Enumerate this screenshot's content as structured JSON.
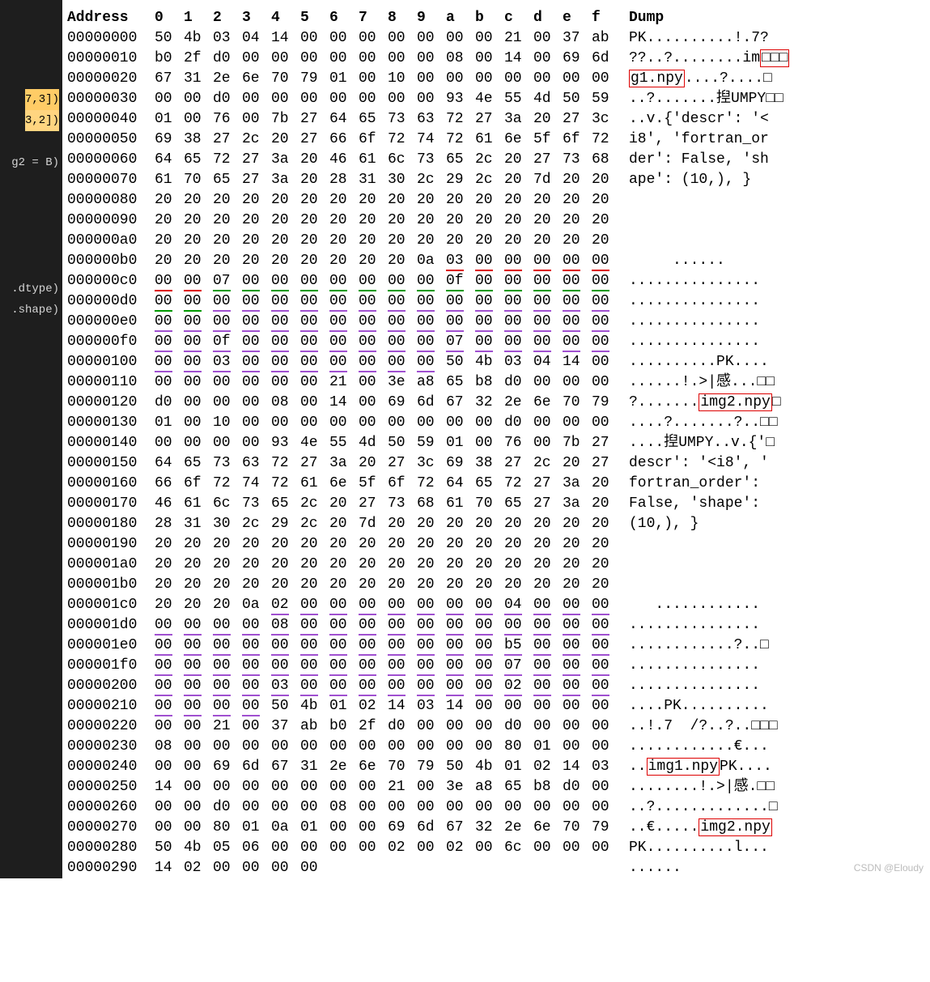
{
  "watermark": "CSDN @Eloudy",
  "left_panel": {
    "l1": "7,3])",
    "l2": "3,2])",
    "l3": "g2 = B)",
    "l4": ".dtype)",
    "l5": ".shape)"
  },
  "headers": [
    "Address",
    "0",
    "1",
    "2",
    "3",
    "4",
    "5",
    "6",
    "7",
    "8",
    "9",
    "a",
    "b",
    "c",
    "d",
    "e",
    "f",
    "Dump"
  ],
  "rows": [
    {
      "a": "00000000",
      "h": [
        "50",
        "4b",
        "03",
        "04",
        "14",
        "00",
        "00",
        "00",
        "00",
        "00",
        "00",
        "00",
        "21",
        "00",
        "37",
        "ab"
      ],
      "d": "PK..........!.7?",
      "u": []
    },
    {
      "a": "00000010",
      "h": [
        "b0",
        "2f",
        "d0",
        "00",
        "00",
        "00",
        "00",
        "00",
        "00",
        "00",
        "08",
        "00",
        "14",
        "00",
        "69",
        "6d"
      ],
      "d": "??..?........im□□□",
      "u": [],
      "dumpBox": [
        15,
        20
      ]
    },
    {
      "a": "00000020",
      "h": [
        "67",
        "31",
        "2e",
        "6e",
        "70",
        "79",
        "01",
        "00",
        "10",
        "00",
        "00",
        "00",
        "00",
        "00",
        "00",
        "00"
      ],
      "d": "g1.npy....?....□",
      "u": [],
      "dumpBox": [
        0,
        6
      ]
    },
    {
      "a": "00000030",
      "h": [
        "00",
        "00",
        "d0",
        "00",
        "00",
        "00",
        "00",
        "00",
        "00",
        "00",
        "93",
        "4e",
        "55",
        "4d",
        "50",
        "59"
      ],
      "d": "..?.......揑UMPY□□",
      "u": []
    },
    {
      "a": "00000040",
      "h": [
        "01",
        "00",
        "76",
        "00",
        "7b",
        "27",
        "64",
        "65",
        "73",
        "63",
        "72",
        "27",
        "3a",
        "20",
        "27",
        "3c"
      ],
      "d": "..v.{'descr': '<",
      "u": []
    },
    {
      "a": "00000050",
      "h": [
        "69",
        "38",
        "27",
        "2c",
        "20",
        "27",
        "66",
        "6f",
        "72",
        "74",
        "72",
        "61",
        "6e",
        "5f",
        "6f",
        "72"
      ],
      "d": "i8', 'fortran_or",
      "u": []
    },
    {
      "a": "00000060",
      "h": [
        "64",
        "65",
        "72",
        "27",
        "3a",
        "20",
        "46",
        "61",
        "6c",
        "73",
        "65",
        "2c",
        "20",
        "27",
        "73",
        "68"
      ],
      "d": "der': False, 'sh",
      "u": []
    },
    {
      "a": "00000070",
      "h": [
        "61",
        "70",
        "65",
        "27",
        "3a",
        "20",
        "28",
        "31",
        "30",
        "2c",
        "29",
        "2c",
        "20",
        "7d",
        "20",
        "20"
      ],
      "d": "ape': (10,), }  ",
      "u": []
    },
    {
      "a": "00000080",
      "h": [
        "20",
        "20",
        "20",
        "20",
        "20",
        "20",
        "20",
        "20",
        "20",
        "20",
        "20",
        "20",
        "20",
        "20",
        "20",
        "20"
      ],
      "d": "",
      "u": []
    },
    {
      "a": "00000090",
      "h": [
        "20",
        "20",
        "20",
        "20",
        "20",
        "20",
        "20",
        "20",
        "20",
        "20",
        "20",
        "20",
        "20",
        "20",
        "20",
        "20"
      ],
      "d": "",
      "u": []
    },
    {
      "a": "000000a0",
      "h": [
        "20",
        "20",
        "20",
        "20",
        "20",
        "20",
        "20",
        "20",
        "20",
        "20",
        "20",
        "20",
        "20",
        "20",
        "20",
        "20"
      ],
      "d": "",
      "u": []
    },
    {
      "a": "000000b0",
      "h": [
        "20",
        "20",
        "20",
        "20",
        "20",
        "20",
        "20",
        "20",
        "20",
        "0a",
        "03",
        "00",
        "00",
        "00",
        "00",
        "00"
      ],
      "d": "     ......",
      "u": [
        [
          "red",
          10,
          15
        ]
      ]
    },
    {
      "a": "000000c0",
      "h": [
        "00",
        "00",
        "07",
        "00",
        "00",
        "00",
        "00",
        "00",
        "00",
        "00",
        "0f",
        "00",
        "00",
        "00",
        "00",
        "00"
      ],
      "d": "...............",
      "u": [
        [
          "red",
          0,
          1
        ],
        [
          "grn",
          2,
          9
        ],
        [
          "grn",
          10,
          15
        ]
      ]
    },
    {
      "a": "000000d0",
      "h": [
        "00",
        "00",
        "00",
        "00",
        "00",
        "00",
        "00",
        "00",
        "00",
        "00",
        "00",
        "00",
        "00",
        "00",
        "00",
        "00"
      ],
      "d": "...............",
      "u": [
        [
          "grn",
          0,
          1
        ],
        [
          "pur",
          2,
          9
        ],
        [
          "pur",
          10,
          15
        ]
      ]
    },
    {
      "a": "000000e0",
      "h": [
        "00",
        "00",
        "00",
        "00",
        "00",
        "00",
        "00",
        "00",
        "00",
        "00",
        "00",
        "00",
        "00",
        "00",
        "00",
        "00"
      ],
      "d": "...............",
      "u": [
        [
          "pur",
          0,
          1
        ],
        [
          "pur",
          2,
          9
        ],
        [
          "pur",
          10,
          15
        ]
      ]
    },
    {
      "a": "000000f0",
      "h": [
        "00",
        "00",
        "0f",
        "00",
        "00",
        "00",
        "00",
        "00",
        "00",
        "00",
        "07",
        "00",
        "00",
        "00",
        "00",
        "00"
      ],
      "d": "...............",
      "u": [
        [
          "pur",
          0,
          1
        ],
        [
          "pur",
          2,
          9
        ],
        [
          "pur",
          10,
          15
        ]
      ]
    },
    {
      "a": "00000100",
      "h": [
        "00",
        "00",
        "03",
        "00",
        "00",
        "00",
        "00",
        "00",
        "00",
        "00",
        "50",
        "4b",
        "03",
        "04",
        "14",
        "00"
      ],
      "d": "..........PK....",
      "u": [
        [
          "pur",
          0,
          1
        ],
        [
          "pur",
          2,
          9
        ]
      ]
    },
    {
      "a": "00000110",
      "h": [
        "00",
        "00",
        "00",
        "00",
        "00",
        "00",
        "21",
        "00",
        "3e",
        "a8",
        "65",
        "b8",
        "d0",
        "00",
        "00",
        "00"
      ],
      "d": "......!.>|感...□□",
      "u": []
    },
    {
      "a": "00000120",
      "h": [
        "d0",
        "00",
        "00",
        "00",
        "08",
        "00",
        "14",
        "00",
        "69",
        "6d",
        "67",
        "32",
        "2e",
        "6e",
        "70",
        "79"
      ],
      "d": "?.......img2.npy□",
      "u": [],
      "dumpBox": [
        8,
        16
      ]
    },
    {
      "a": "00000130",
      "h": [
        "01",
        "00",
        "10",
        "00",
        "00",
        "00",
        "00",
        "00",
        "00",
        "00",
        "00",
        "00",
        "d0",
        "00",
        "00",
        "00"
      ],
      "d": "....?.......?..□□",
      "u": []
    },
    {
      "a": "00000140",
      "h": [
        "00",
        "00",
        "00",
        "00",
        "93",
        "4e",
        "55",
        "4d",
        "50",
        "59",
        "01",
        "00",
        "76",
        "00",
        "7b",
        "27"
      ],
      "d": "....揑UMPY..v.{'□",
      "u": []
    },
    {
      "a": "00000150",
      "h": [
        "64",
        "65",
        "73",
        "63",
        "72",
        "27",
        "3a",
        "20",
        "27",
        "3c",
        "69",
        "38",
        "27",
        "2c",
        "20",
        "27"
      ],
      "d": "descr': '<i8', '",
      "u": []
    },
    {
      "a": "00000160",
      "h": [
        "66",
        "6f",
        "72",
        "74",
        "72",
        "61",
        "6e",
        "5f",
        "6f",
        "72",
        "64",
        "65",
        "72",
        "27",
        "3a",
        "20"
      ],
      "d": "fortran_order': ",
      "u": []
    },
    {
      "a": "00000170",
      "h": [
        "46",
        "61",
        "6c",
        "73",
        "65",
        "2c",
        "20",
        "27",
        "73",
        "68",
        "61",
        "70",
        "65",
        "27",
        "3a",
        "20"
      ],
      "d": "False, 'shape': ",
      "u": []
    },
    {
      "a": "00000180",
      "h": [
        "28",
        "31",
        "30",
        "2c",
        "29",
        "2c",
        "20",
        "7d",
        "20",
        "20",
        "20",
        "20",
        "20",
        "20",
        "20",
        "20"
      ],
      "d": "(10,), }        ",
      "u": []
    },
    {
      "a": "00000190",
      "h": [
        "20",
        "20",
        "20",
        "20",
        "20",
        "20",
        "20",
        "20",
        "20",
        "20",
        "20",
        "20",
        "20",
        "20",
        "20",
        "20"
      ],
      "d": "",
      "u": []
    },
    {
      "a": "000001a0",
      "h": [
        "20",
        "20",
        "20",
        "20",
        "20",
        "20",
        "20",
        "20",
        "20",
        "20",
        "20",
        "20",
        "20",
        "20",
        "20",
        "20"
      ],
      "d": "",
      "u": []
    },
    {
      "a": "000001b0",
      "h": [
        "20",
        "20",
        "20",
        "20",
        "20",
        "20",
        "20",
        "20",
        "20",
        "20",
        "20",
        "20",
        "20",
        "20",
        "20",
        "20"
      ],
      "d": "",
      "u": []
    },
    {
      "a": "000001c0",
      "h": [
        "20",
        "20",
        "20",
        "0a",
        "02",
        "00",
        "00",
        "00",
        "00",
        "00",
        "00",
        "00",
        "04",
        "00",
        "00",
        "00"
      ],
      "d": "   ............",
      "u": [
        [
          "pur",
          4,
          11
        ],
        [
          "pur",
          12,
          15
        ]
      ]
    },
    {
      "a": "000001d0",
      "h": [
        "00",
        "00",
        "00",
        "00",
        "08",
        "00",
        "00",
        "00",
        "00",
        "00",
        "00",
        "00",
        "00",
        "00",
        "00",
        "00"
      ],
      "d": "...............",
      "u": [
        [
          "pur",
          0,
          3
        ],
        [
          "pur",
          4,
          11
        ],
        [
          "pur",
          12,
          15
        ]
      ]
    },
    {
      "a": "000001e0",
      "h": [
        "00",
        "00",
        "00",
        "00",
        "00",
        "00",
        "00",
        "00",
        "00",
        "00",
        "00",
        "00",
        "b5",
        "00",
        "00",
        "00"
      ],
      "d": "............?..□",
      "u": [
        [
          "pur",
          0,
          3
        ],
        [
          "pur",
          4,
          11
        ],
        [
          "pur",
          12,
          15
        ]
      ]
    },
    {
      "a": "000001f0",
      "h": [
        "00",
        "00",
        "00",
        "00",
        "00",
        "00",
        "00",
        "00",
        "00",
        "00",
        "00",
        "00",
        "07",
        "00",
        "00",
        "00"
      ],
      "d": "...............",
      "u": [
        [
          "pur",
          0,
          3
        ],
        [
          "pur",
          4,
          11
        ],
        [
          "pur",
          12,
          15
        ]
      ]
    },
    {
      "a": "00000200",
      "h": [
        "00",
        "00",
        "00",
        "00",
        "03",
        "00",
        "00",
        "00",
        "00",
        "00",
        "00",
        "00",
        "02",
        "00",
        "00",
        "00"
      ],
      "d": "...............",
      "u": [
        [
          "pur",
          0,
          3
        ],
        [
          "pur",
          4,
          11
        ],
        [
          "pur",
          12,
          15
        ]
      ]
    },
    {
      "a": "00000210",
      "h": [
        "00",
        "00",
        "00",
        "00",
        "50",
        "4b",
        "01",
        "02",
        "14",
        "03",
        "14",
        "00",
        "00",
        "00",
        "00",
        "00"
      ],
      "d": "....PK..........",
      "u": [
        [
          "pur",
          0,
          3
        ]
      ]
    },
    {
      "a": "00000220",
      "h": [
        "00",
        "00",
        "21",
        "00",
        "37",
        "ab",
        "b0",
        "2f",
        "d0",
        "00",
        "00",
        "00",
        "d0",
        "00",
        "00",
        "00"
      ],
      "d": "..!.7  /?..?..□□□",
      "u": []
    },
    {
      "a": "00000230",
      "h": [
        "08",
        "00",
        "00",
        "00",
        "00",
        "00",
        "00",
        "00",
        "00",
        "00",
        "00",
        "00",
        "80",
        "01",
        "00",
        "00"
      ],
      "d": "............€...",
      "u": []
    },
    {
      "a": "00000240",
      "h": [
        "00",
        "00",
        "69",
        "6d",
        "67",
        "31",
        "2e",
        "6e",
        "70",
        "79",
        "50",
        "4b",
        "01",
        "02",
        "14",
        "03"
      ],
      "d": "..img1.npyPK....",
      "u": [],
      "dumpBox": [
        2,
        10
      ]
    },
    {
      "a": "00000250",
      "h": [
        "14",
        "00",
        "00",
        "00",
        "00",
        "00",
        "00",
        "00",
        "21",
        "00",
        "3e",
        "a8",
        "65",
        "b8",
        "d0",
        "00"
      ],
      "d": "........!.>|感.□□",
      "u": []
    },
    {
      "a": "00000260",
      "h": [
        "00",
        "00",
        "d0",
        "00",
        "00",
        "00",
        "08",
        "00",
        "00",
        "00",
        "00",
        "00",
        "00",
        "00",
        "00",
        "00"
      ],
      "d": "..?.............□",
      "u": []
    },
    {
      "a": "00000270",
      "h": [
        "00",
        "00",
        "80",
        "01",
        "0a",
        "01",
        "00",
        "00",
        "69",
        "6d",
        "67",
        "32",
        "2e",
        "6e",
        "70",
        "79"
      ],
      "d": "..€.....img2.npy",
      "u": [],
      "dumpBox": [
        8,
        16
      ]
    },
    {
      "a": "00000280",
      "h": [
        "50",
        "4b",
        "05",
        "06",
        "00",
        "00",
        "00",
        "00",
        "02",
        "00",
        "02",
        "00",
        "6c",
        "00",
        "00",
        "00"
      ],
      "d": "PK..........l...",
      "u": []
    },
    {
      "a": "00000290",
      "h": [
        "14",
        "02",
        "00",
        "00",
        "00",
        "00"
      ],
      "d": "......",
      "u": []
    }
  ]
}
